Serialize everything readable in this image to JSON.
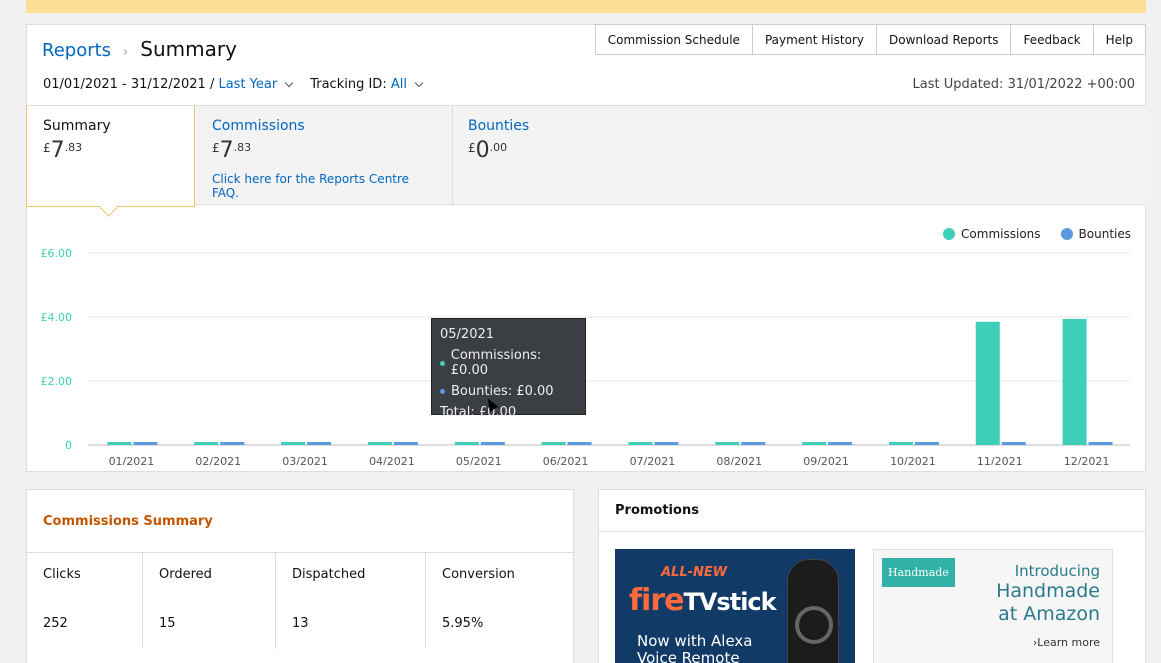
{
  "header": {
    "breadcrumb_root": "Reports",
    "breadcrumb_sep": "›",
    "title": "Summary",
    "nav": [
      "Commission Schedule",
      "Payment History",
      "Download Reports",
      "Feedback",
      "Help"
    ]
  },
  "filters": {
    "date_range": "01/01/2021 - 31/12/2021 /",
    "period": "Last Year",
    "tracking_label": "Tracking ID:",
    "tracking_value": "All",
    "last_updated": "Last Updated: 31/01/2022 +00:00"
  },
  "tabs": {
    "summary": {
      "label": "Summary",
      "currency": "£",
      "whole": "7",
      "decimal": ".83"
    },
    "commissions": {
      "label": "Commissions",
      "currency": "£",
      "whole": "7",
      "decimal": ".83",
      "faq": "Click here for the Reports Centre FAQ."
    },
    "bounties": {
      "label": "Bounties",
      "currency": "£",
      "whole": "0",
      "decimal": ".00"
    }
  },
  "colors": {
    "commissions": "#3ecfb8",
    "bounties": "#5b9ae0",
    "accent": "#0066c0",
    "highlight": "#c45500"
  },
  "chart_data": {
    "type": "bar",
    "categories": [
      "01/2021",
      "02/2021",
      "03/2021",
      "04/2021",
      "05/2021",
      "06/2021",
      "07/2021",
      "08/2021",
      "09/2021",
      "10/2021",
      "11/2021",
      "12/2021"
    ],
    "series": [
      {
        "name": "Commissions",
        "values": [
          0,
          0,
          0,
          0,
          0,
          0,
          0,
          0,
          0,
          0,
          3.85,
          3.94
        ]
      },
      {
        "name": "Bounties",
        "values": [
          0,
          0,
          0,
          0,
          0,
          0,
          0,
          0,
          0,
          0,
          0,
          0
        ]
      }
    ],
    "yticks": [
      "0",
      "£2.00",
      "£4.00",
      "£6.00"
    ],
    "ylim": [
      0,
      6
    ],
    "grid": true,
    "legend_position": "top-right"
  },
  "tooltip": {
    "title": "05/2021",
    "commissions": "Commissions: £0.00",
    "bounties": "Bounties: £0.00",
    "total": "Total: £0.00"
  },
  "commissions_summary": {
    "title": "Commissions Summary",
    "stats": [
      {
        "label": "Clicks",
        "value": "252"
      },
      {
        "label": "Ordered",
        "value": "15"
      },
      {
        "label": "Dispatched",
        "value": "13"
      },
      {
        "label": "Conversion",
        "value": "5.95%"
      }
    ]
  },
  "promotions": {
    "title": "Promotions",
    "fire": {
      "tag": "ALL-NEW",
      "logo_fire": "fire",
      "logo_tv": "TVstick",
      "sub": "Now with Alexa Voice Remote"
    },
    "handmade": {
      "tag": "Handmade",
      "line1": "Introducing",
      "line2": "Handmade",
      "line3": "at Amazon",
      "link": "›Learn more"
    }
  }
}
